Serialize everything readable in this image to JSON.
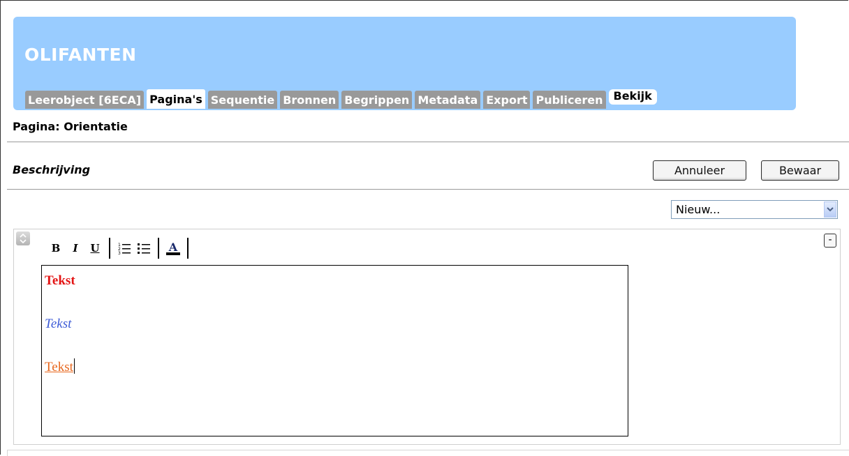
{
  "header": {
    "title": "OLIFANTEN",
    "tabs": [
      {
        "label": "Leerobject [6ECA]",
        "active": false
      },
      {
        "label": "Pagina's",
        "active": true
      },
      {
        "label": "Sequentie",
        "active": false
      },
      {
        "label": "Bronnen",
        "active": false
      },
      {
        "label": "Begrippen",
        "active": false
      },
      {
        "label": "Metadata",
        "active": false
      },
      {
        "label": "Export",
        "active": false
      },
      {
        "label": "Publiceren",
        "active": false
      }
    ],
    "view_tab": "Bekijk"
  },
  "page": {
    "label": "Pagina: Orientatie"
  },
  "section": {
    "title": "Beschrijving",
    "cancel_label": "Annuleer",
    "save_label": "Bewaar",
    "new_select_value": "Nieuw..."
  },
  "toolbar": {
    "bold": "B",
    "italic": "I",
    "underline": "U",
    "icons": [
      "bold-icon",
      "italic-icon",
      "underline-icon",
      "ordered-list-icon",
      "bullet-list-icon",
      "text-color-icon"
    ]
  },
  "editor": {
    "collapse_label": "-",
    "lines": [
      {
        "text": "Tekst",
        "style": "bold",
        "color": "#e31414"
      },
      {
        "text": "Tekst",
        "style": "italic",
        "color": "#3c5ad6"
      },
      {
        "text": "Tekst",
        "style": "underline",
        "color": "#e8661c"
      }
    ]
  },
  "colors": {
    "header_bg": "#99ccff",
    "tab_bg": "#999999",
    "text_red": "#e31414",
    "text_blue": "#3c5ad6",
    "text_orange": "#e8661c"
  }
}
